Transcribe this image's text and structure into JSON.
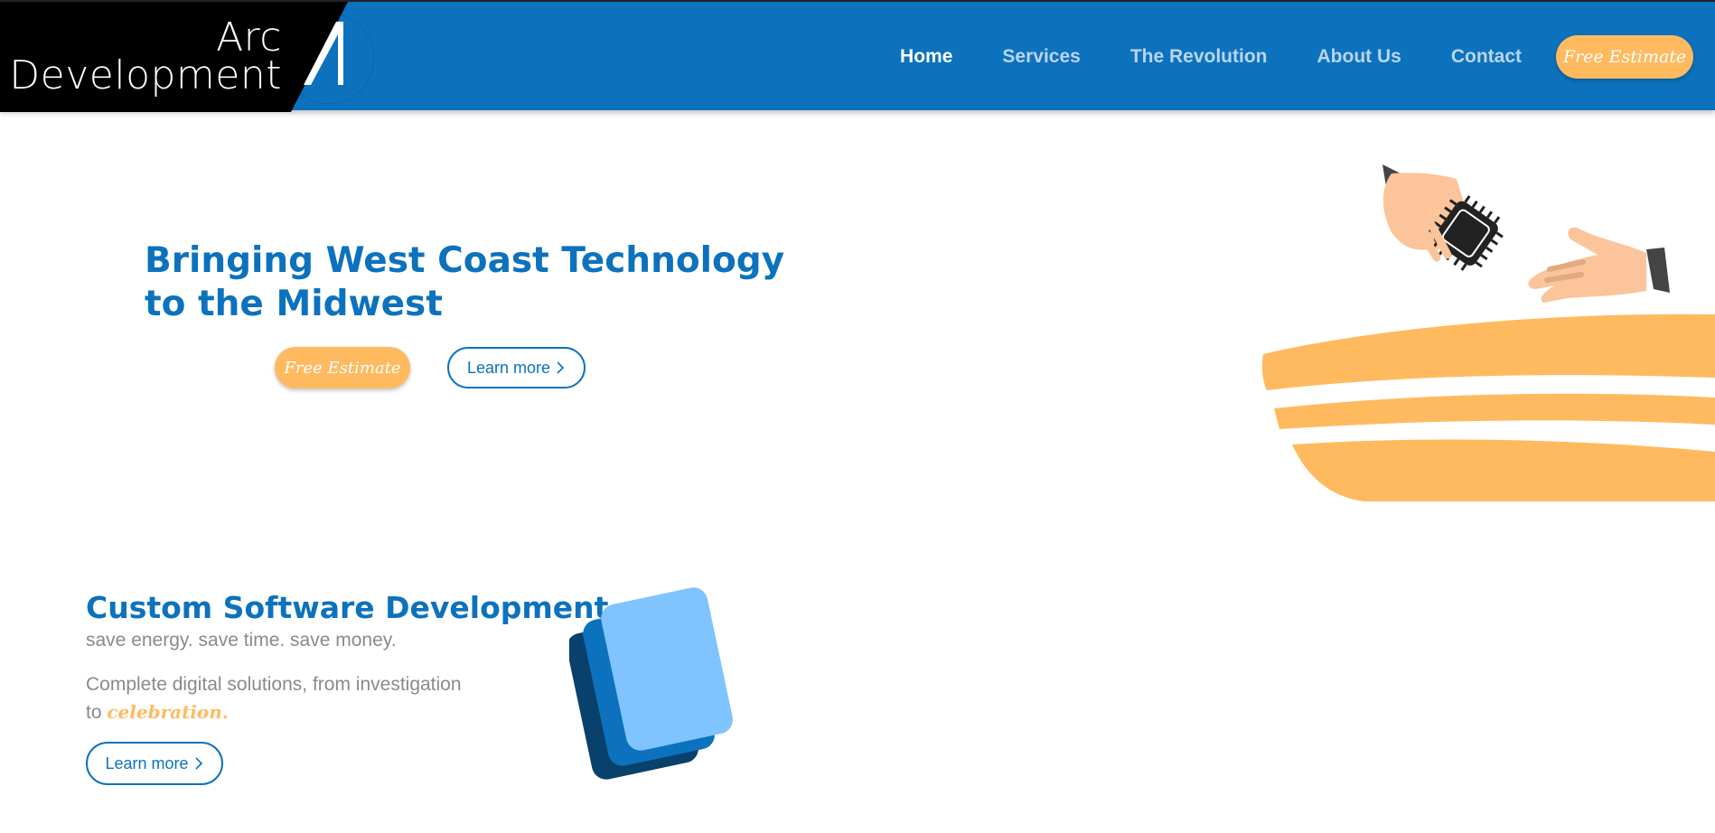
{
  "logo": {
    "line1": "Arc",
    "line2": "Development"
  },
  "nav": {
    "items": [
      {
        "label": "Home",
        "active": true
      },
      {
        "label": "Services",
        "active": false
      },
      {
        "label": "The Revolution",
        "active": false
      },
      {
        "label": "About Us",
        "active": false
      },
      {
        "label": "Contact",
        "active": false
      }
    ],
    "estimate_label": "Free Estimate"
  },
  "hero": {
    "title_line1": "Bringing West Coast Technology",
    "title_line2": "to the Midwest",
    "estimate_label": "Free Estimate",
    "learn_label": "Learn more"
  },
  "services": {
    "title": "Custom Software Development",
    "subtitle": "save energy. save time. save money.",
    "desc_line1": "Complete digital solutions, from investigation",
    "desc_line2_prefix": "to",
    "desc_highlight": "celebration.",
    "learn_label": "Learn more"
  },
  "colors": {
    "brand_blue": "#0c72bd",
    "accent_orange": "#ffba60",
    "light_blue": "#7fc3ff",
    "dark_blue": "#08416b",
    "text_gray": "#8a8a8a"
  },
  "icons": {
    "logo": "arc-logo-icon",
    "chevron": "chevron-right-icon",
    "hero_art": "handshake-chip-illustration",
    "services": "stacked-cards-icon"
  }
}
